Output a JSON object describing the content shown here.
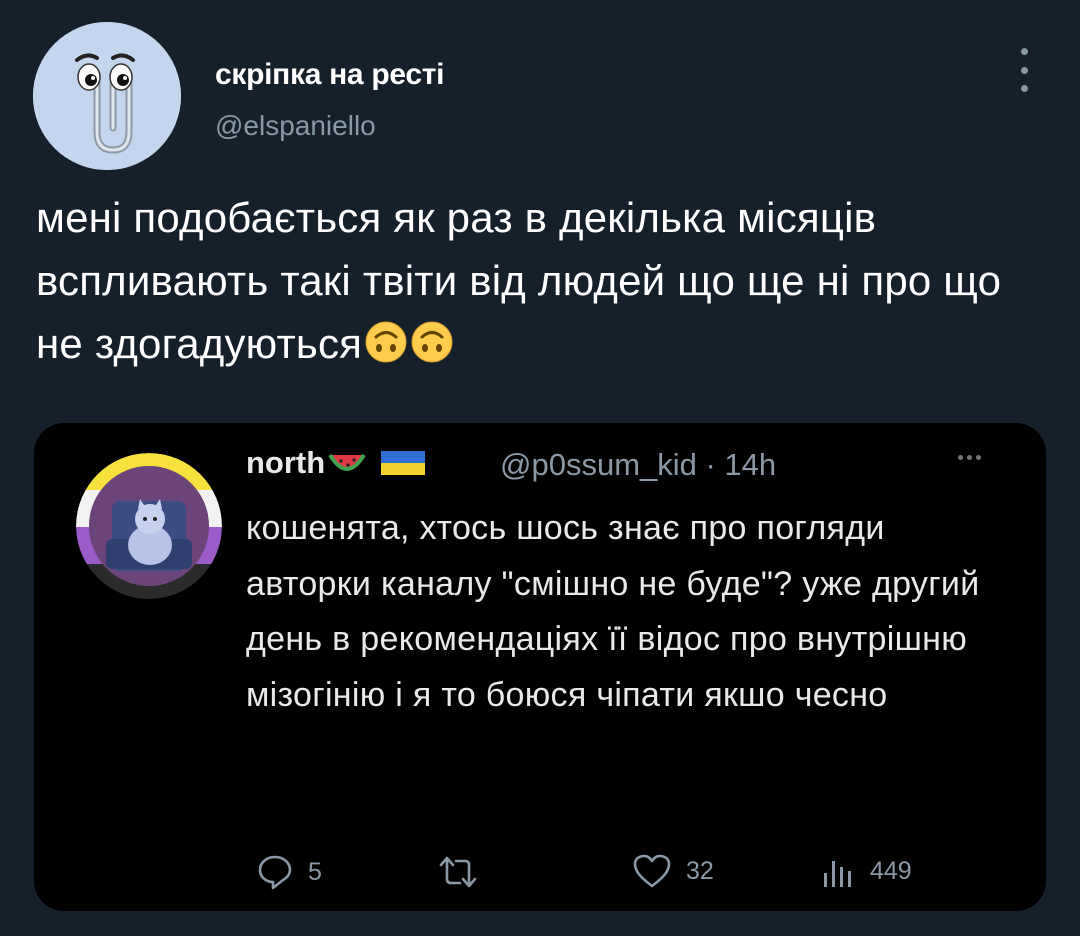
{
  "author": {
    "name": "скріпка на ресті",
    "handle": "@elspaniello"
  },
  "tweet": {
    "text": "мені подобається як раз в декілька місяців вспливають такі твіти від людей що ще ні про що не здогадуються",
    "emoji": [
      "upside-down-face-emoji",
      "upside-down-face-emoji"
    ]
  },
  "quote": {
    "name": "north",
    "name_emoji": [
      "watermelon-emoji",
      "ukraine-flag-emoji"
    ],
    "handle_time": "@p0ssum_kid · 14h",
    "text": "кошенята, хтось шось знає про погляди авторки каналу \"смішно не буде\"? уже другий день в рекомендаціях її відос про внутрішню мізогінію і я то боюся чіпати якшо чесно",
    "actions": {
      "replies": "5",
      "retweets": "",
      "likes": "32",
      "views": "449"
    }
  },
  "colors": {
    "background": "#15202b",
    "quote_background": "#000000",
    "secondary_text": "#8899a6",
    "avatar_bg": "#c3d6ee"
  }
}
